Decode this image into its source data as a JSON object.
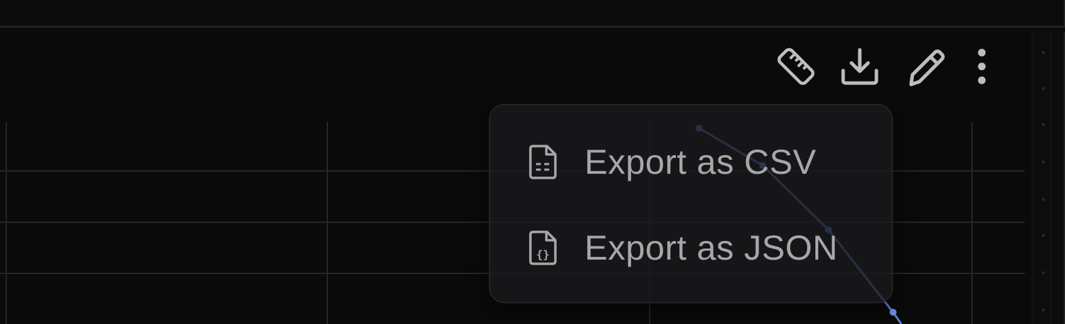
{
  "toolbar": {
    "items": [
      {
        "icon": "ruler-icon"
      },
      {
        "icon": "download-icon"
      },
      {
        "icon": "pencil-icon"
      },
      {
        "icon": "more-vertical-icon"
      }
    ],
    "icon_color": "#bdbdc0"
  },
  "export_menu": {
    "items": [
      {
        "label": "Export as CSV",
        "icon": "csv-file-icon"
      },
      {
        "label": "Export as JSON",
        "icon": "json-file-icon"
      }
    ]
  },
  "colors": {
    "background": "#0a0a0b",
    "grid": "#262628",
    "series": "#5b7fd6",
    "menu_text": "#a7a7aa"
  }
}
